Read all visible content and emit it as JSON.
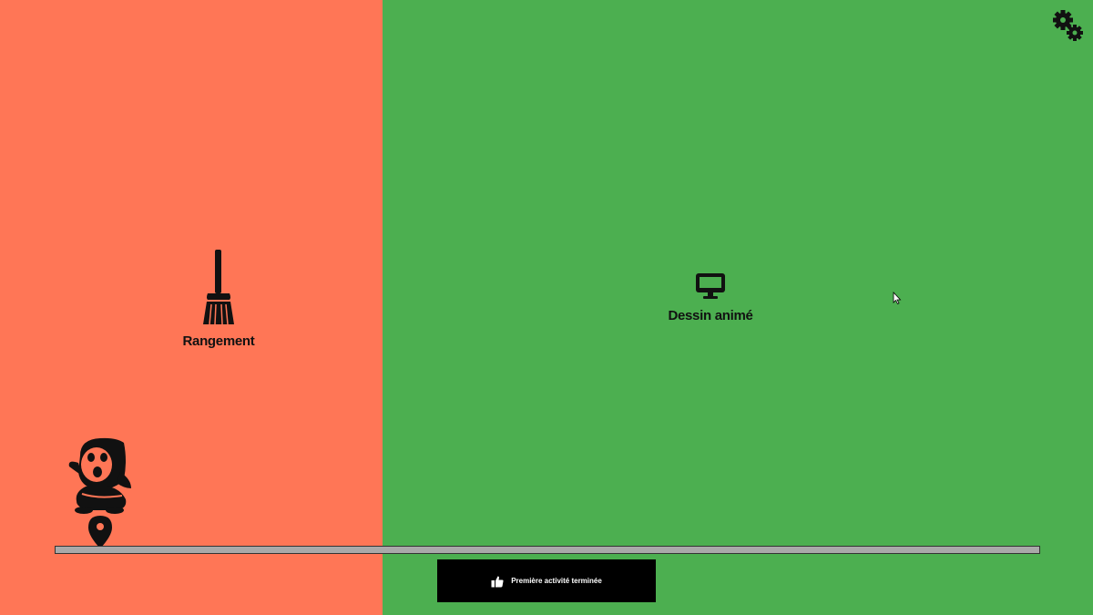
{
  "colors": {
    "left_panel": "#ff7656",
    "right_panel": "#4caf50",
    "icon": "#111111",
    "timeline": "#a9a9a9",
    "status_bg": "#000000",
    "status_text": "#ffffff"
  },
  "activities": [
    {
      "label": "Rangement",
      "icon": "broom-icon"
    },
    {
      "label": "Dessin animé",
      "icon": "monitor-icon"
    }
  ],
  "header": {
    "settings_icon": "gears-icon"
  },
  "timeline": {
    "marker_icon": "location-pin-icon",
    "mascot_icon": "hooded-character-icon"
  },
  "status": {
    "icon": "thumbs-up-icon",
    "text": "Première activité terminée"
  }
}
